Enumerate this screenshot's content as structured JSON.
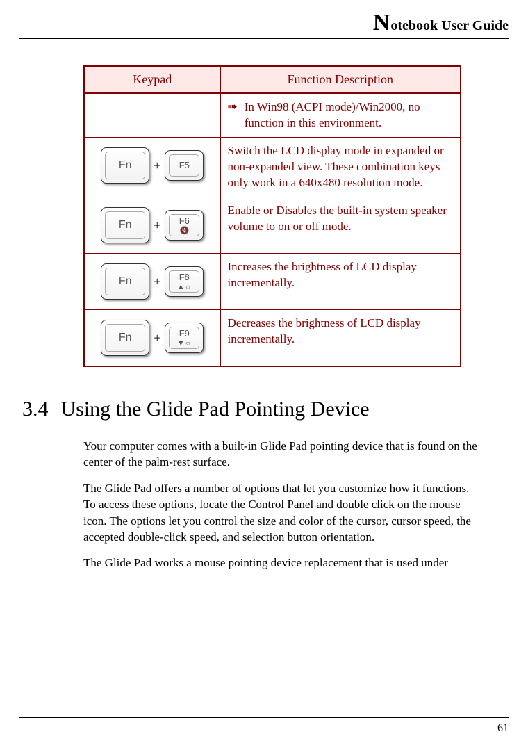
{
  "header": {
    "big_initial": "N",
    "rest": "otebook User Guide"
  },
  "table": {
    "head": {
      "keypad": "Keypad",
      "desc": "Function Description"
    },
    "rows": [
      {
        "keypad": null,
        "bullet": "➠",
        "desc": "In Win98 (ACPI mode)/Win2000, no function in this environment."
      },
      {
        "fn": "Fn",
        "plus": "+",
        "fkey": "F5",
        "fsym": "",
        "desc": "Switch the LCD display mode in expanded or non-expanded view. These combination keys only work in a 640x480 resolution mode."
      },
      {
        "fn": "Fn",
        "plus": "+",
        "fkey": "F6",
        "fsym": "🔇",
        "desc": "Enable or Disables the built-in system speaker volume to on or off mode."
      },
      {
        "fn": "Fn",
        "plus": "+",
        "fkey": "F8",
        "fsym": "▲☼",
        "desc": "Increases the brightness of LCD display incrementally."
      },
      {
        "fn": "Fn",
        "plus": "+",
        "fkey": "F9",
        "fsym": "▼☼",
        "desc": "Decreases the brightness of LCD display incrementally."
      }
    ]
  },
  "section": {
    "num": "3.4",
    "title": "Using the Glide Pad Pointing Device"
  },
  "paragraphs": {
    "p1": "Your computer comes with a built-in Glide Pad pointing device that is found on the center of the palm-rest surface.",
    "p2": "The Glide Pad offers a number of options that let you customize how it functions. To access these options, locate the Control Panel and double click on the mouse icon. The options let you control the size and color of the cursor, cursor speed, the accepted double-click speed, and selection button orientation.",
    "p3": "The Glide Pad works a mouse pointing device replacement that is used under"
  },
  "page_number": "61"
}
